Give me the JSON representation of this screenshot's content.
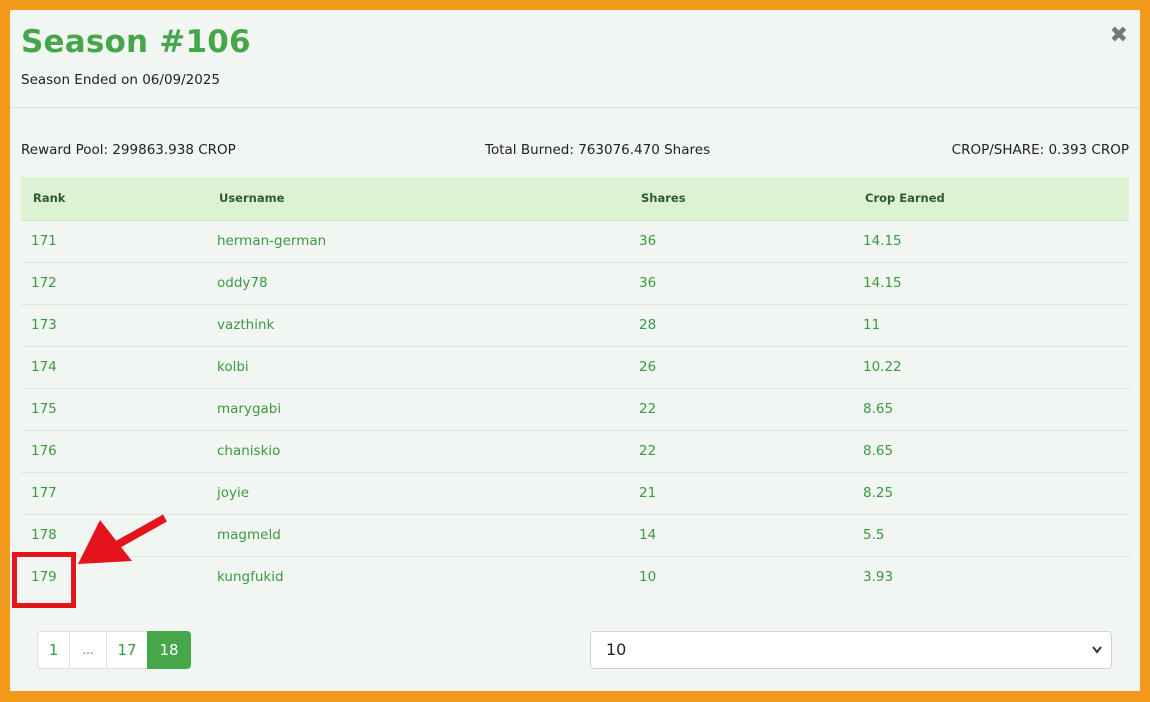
{
  "modal": {
    "title": "Season #106",
    "subtitle": "Season Ended on 06/09/2025",
    "close_label": "✖"
  },
  "stats": {
    "reward_pool": "Reward Pool: 299863.938 CROP",
    "total_burned": "Total Burned: 763076.470 Shares",
    "crop_per_share": "CROP/SHARE: 0.393 CROP"
  },
  "table": {
    "headers": [
      "Rank",
      "Username",
      "Shares",
      "Crop Earned"
    ],
    "rows": [
      [
        "171",
        "herman-german",
        "36",
        "14.15"
      ],
      [
        "172",
        "oddy78",
        "36",
        "14.15"
      ],
      [
        "173",
        "vazthink",
        "28",
        "11"
      ],
      [
        "174",
        "kolbi",
        "26",
        "10.22"
      ],
      [
        "175",
        "marygabi",
        "22",
        "8.65"
      ],
      [
        "176",
        "chaniskio",
        "22",
        "8.65"
      ],
      [
        "177",
        "joyie",
        "21",
        "8.25"
      ],
      [
        "178",
        "magmeld",
        "14",
        "5.5"
      ],
      [
        "179",
        "kungfukid",
        "10",
        "3.93"
      ]
    ]
  },
  "pagination": {
    "pages": [
      "1",
      "...",
      "17",
      "18"
    ],
    "active": "18"
  },
  "page_size": {
    "selected": "10"
  },
  "colors": {
    "accent": "#45a64a",
    "frame": "#f29a1c",
    "annotation": "#e3141c",
    "header_row": "#dcf2d2"
  },
  "icons": {
    "close": "close-icon",
    "select": "chevron-down-icon",
    "annotation": "arrow-icon"
  }
}
